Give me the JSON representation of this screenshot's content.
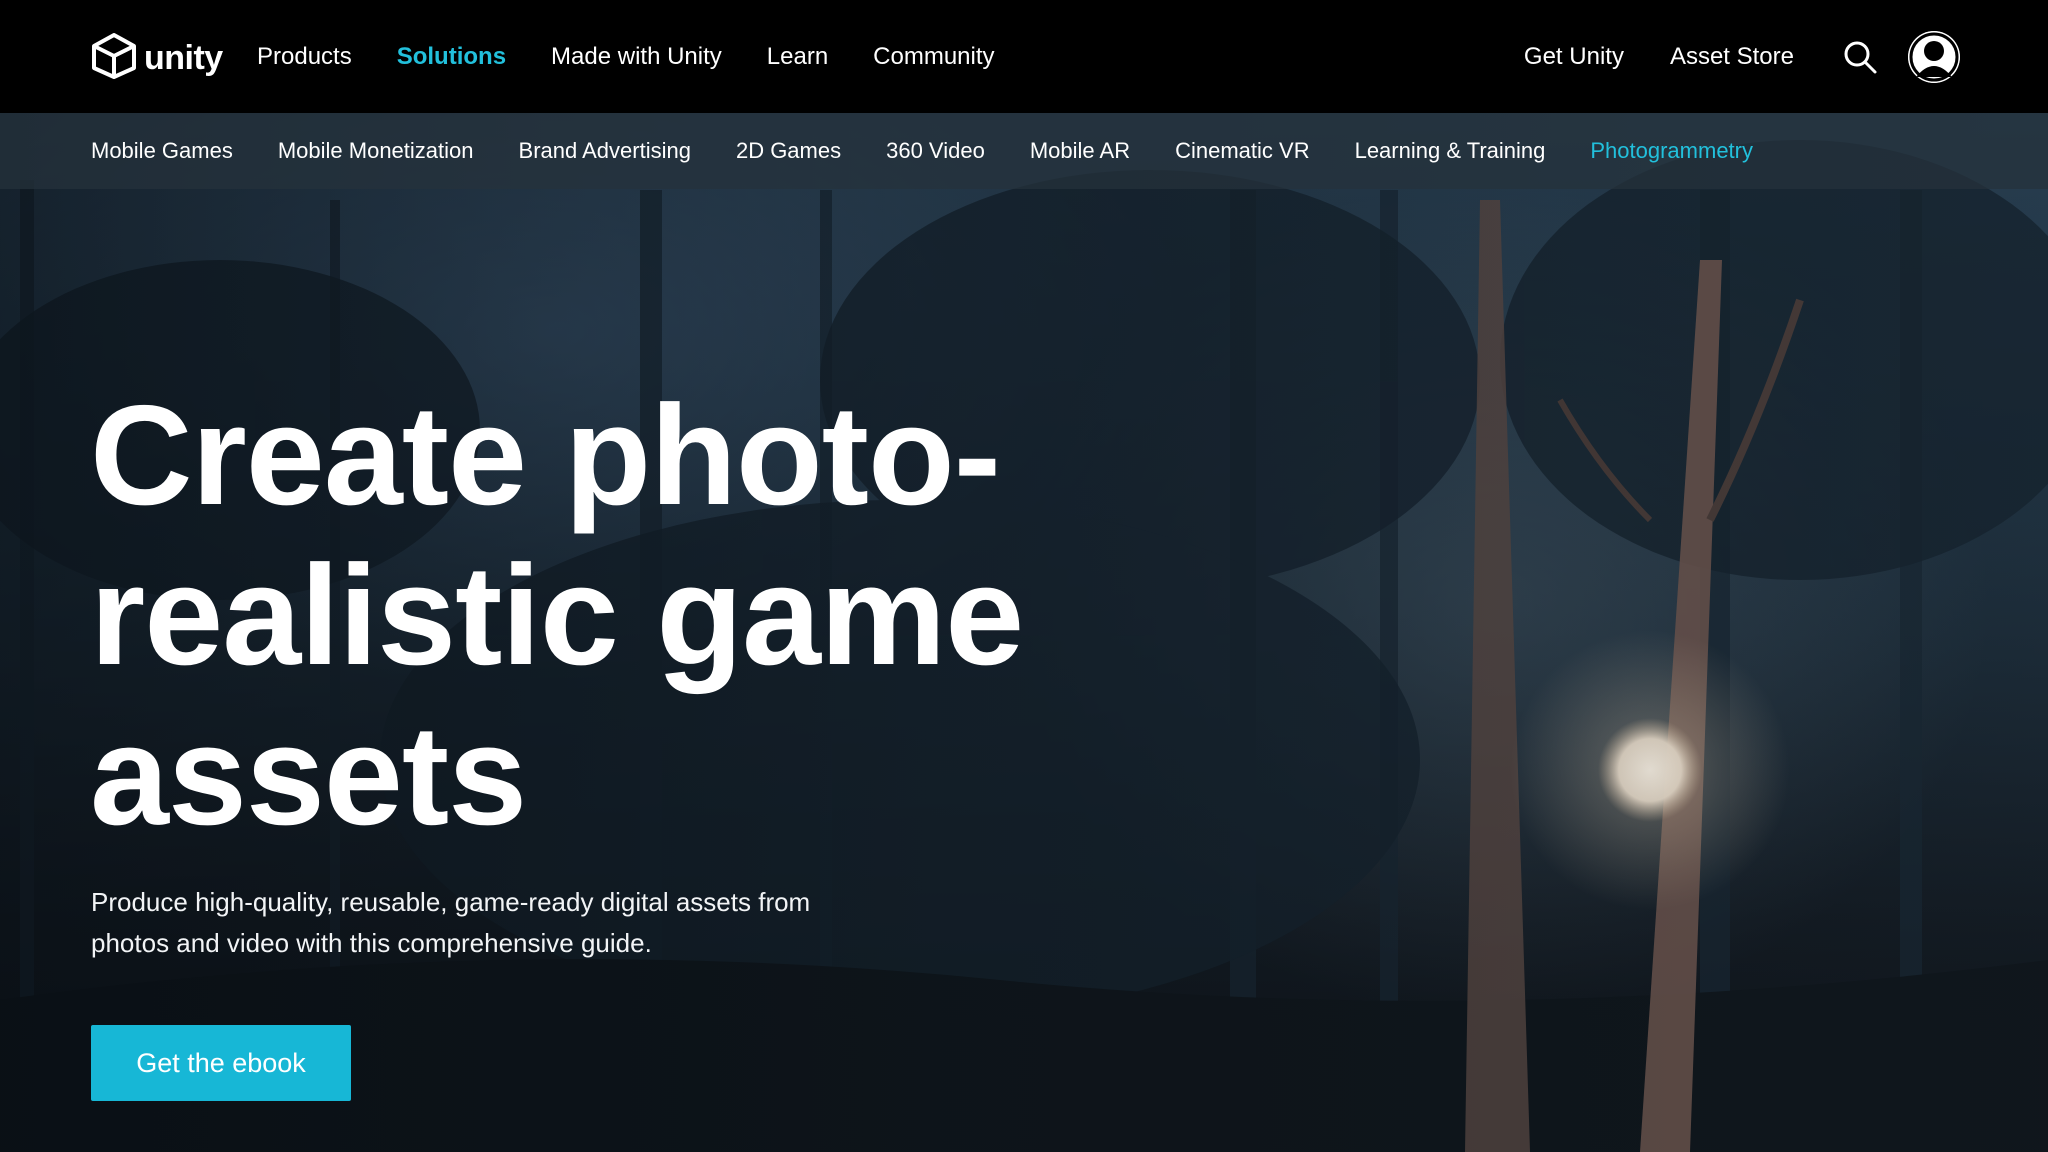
{
  "brand": {
    "logo_text": "unity",
    "logo_icon": "unity-cube-icon"
  },
  "main_nav": {
    "items": [
      {
        "label": "Products",
        "active": false
      },
      {
        "label": "Solutions",
        "active": true
      },
      {
        "label": "Made with Unity",
        "active": false
      },
      {
        "label": "Learn",
        "active": false
      },
      {
        "label": "Community",
        "active": false
      }
    ],
    "right": {
      "get_unity": "Get Unity",
      "asset_store": "Asset Store",
      "search_icon": "search-icon",
      "account_icon": "user-account-icon"
    }
  },
  "sub_nav": {
    "items": [
      {
        "label": "Mobile Games",
        "active": false
      },
      {
        "label": "Mobile Monetization",
        "active": false
      },
      {
        "label": "Brand Advertising",
        "active": false
      },
      {
        "label": "2D Games",
        "active": false
      },
      {
        "label": "360 Video",
        "active": false
      },
      {
        "label": "Mobile AR",
        "active": false
      },
      {
        "label": "Cinematic VR",
        "active": false
      },
      {
        "label": "Learning & Training",
        "active": false
      },
      {
        "label": "Photogrammetry",
        "active": true
      }
    ]
  },
  "hero": {
    "title_lines": [
      "Create photo-",
      "realistic game",
      "assets"
    ],
    "description": "Produce high-quality, reusable, game-ready digital assets from photos and video with this comprehensive guide.",
    "cta_label": "Get the ebook"
  },
  "colors": {
    "accent": "#22c0dc",
    "cta": "#17b7d6",
    "topbar": "#000000"
  }
}
